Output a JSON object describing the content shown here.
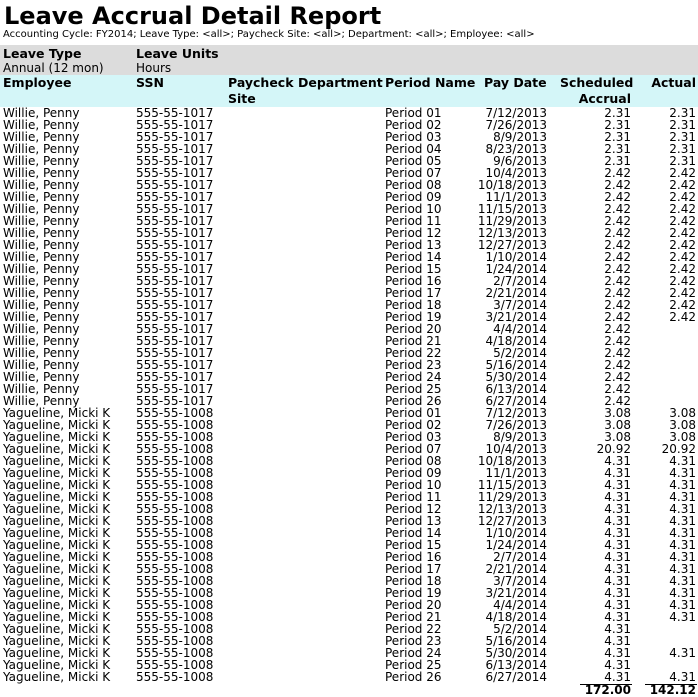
{
  "report": {
    "title": "Leave Accrual Detail Report",
    "subtitle": "Accounting Cycle: FY2014; Leave Type: <all>; Paycheck Site: <all>; Department: <all>; Employee: <all>"
  },
  "group_header": {
    "leave_type_label": "Leave Type",
    "leave_type_value": "Annual (12 mon)",
    "leave_units_label": "Leave Units",
    "leave_units_value": "Hours"
  },
  "columns": {
    "employee": "Employee",
    "ssn": "SSN",
    "paycheck_site_1": "Paycheck",
    "paycheck_site_2": "Site",
    "department": "Department",
    "period_name": "Period Name",
    "pay_date": "Pay Date",
    "scheduled_1": "Scheduled",
    "scheduled_2": "Accrual",
    "actual": "Actual"
  },
  "rows": [
    {
      "employee": "Willie,  Penny",
      "ssn": "555-55-1017",
      "period": "Period 01",
      "pay_date": "7/12/2013",
      "scheduled": "2.31",
      "actual": "2.31"
    },
    {
      "employee": "Willie,  Penny",
      "ssn": "555-55-1017",
      "period": "Period 02",
      "pay_date": "7/26/2013",
      "scheduled": "2.31",
      "actual": "2.31"
    },
    {
      "employee": "Willie,  Penny",
      "ssn": "555-55-1017",
      "period": "Period 03",
      "pay_date": "8/9/2013",
      "scheduled": "2.31",
      "actual": "2.31"
    },
    {
      "employee": "Willie,  Penny",
      "ssn": "555-55-1017",
      "period": "Period 04",
      "pay_date": "8/23/2013",
      "scheduled": "2.31",
      "actual": "2.31"
    },
    {
      "employee": "Willie,  Penny",
      "ssn": "555-55-1017",
      "period": "Period 05",
      "pay_date": "9/6/2013",
      "scheduled": "2.31",
      "actual": "2.31"
    },
    {
      "employee": "Willie,  Penny",
      "ssn": "555-55-1017",
      "period": "Period 07",
      "pay_date": "10/4/2013",
      "scheduled": "2.42",
      "actual": "2.42"
    },
    {
      "employee": "Willie,  Penny",
      "ssn": "555-55-1017",
      "period": "Period 08",
      "pay_date": "10/18/2013",
      "scheduled": "2.42",
      "actual": "2.42"
    },
    {
      "employee": "Willie,  Penny",
      "ssn": "555-55-1017",
      "period": "Period 09",
      "pay_date": "11/1/2013",
      "scheduled": "2.42",
      "actual": "2.42"
    },
    {
      "employee": "Willie,  Penny",
      "ssn": "555-55-1017",
      "period": "Period 10",
      "pay_date": "11/15/2013",
      "scheduled": "2.42",
      "actual": "2.42"
    },
    {
      "employee": "Willie,  Penny",
      "ssn": "555-55-1017",
      "period": "Period 11",
      "pay_date": "11/29/2013",
      "scheduled": "2.42",
      "actual": "2.42"
    },
    {
      "employee": "Willie,  Penny",
      "ssn": "555-55-1017",
      "period": "Period 12",
      "pay_date": "12/13/2013",
      "scheduled": "2.42",
      "actual": "2.42"
    },
    {
      "employee": "Willie,  Penny",
      "ssn": "555-55-1017",
      "period": "Period 13",
      "pay_date": "12/27/2013",
      "scheduled": "2.42",
      "actual": "2.42"
    },
    {
      "employee": "Willie,  Penny",
      "ssn": "555-55-1017",
      "period": "Period 14",
      "pay_date": "1/10/2014",
      "scheduled": "2.42",
      "actual": "2.42"
    },
    {
      "employee": "Willie,  Penny",
      "ssn": "555-55-1017",
      "period": "Period 15",
      "pay_date": "1/24/2014",
      "scheduled": "2.42",
      "actual": "2.42"
    },
    {
      "employee": "Willie,  Penny",
      "ssn": "555-55-1017",
      "period": "Period 16",
      "pay_date": "2/7/2014",
      "scheduled": "2.42",
      "actual": "2.42"
    },
    {
      "employee": "Willie,  Penny",
      "ssn": "555-55-1017",
      "period": "Period 17",
      "pay_date": "2/21/2014",
      "scheduled": "2.42",
      "actual": "2.42"
    },
    {
      "employee": "Willie,  Penny",
      "ssn": "555-55-1017",
      "period": "Period 18",
      "pay_date": "3/7/2014",
      "scheduled": "2.42",
      "actual": "2.42"
    },
    {
      "employee": "Willie,  Penny",
      "ssn": "555-55-1017",
      "period": "Period 19",
      "pay_date": "3/21/2014",
      "scheduled": "2.42",
      "actual": "2.42"
    },
    {
      "employee": "Willie,  Penny",
      "ssn": "555-55-1017",
      "period": "Period 20",
      "pay_date": "4/4/2014",
      "scheduled": "2.42",
      "actual": ""
    },
    {
      "employee": "Willie,  Penny",
      "ssn": "555-55-1017",
      "period": "Period 21",
      "pay_date": "4/18/2014",
      "scheduled": "2.42",
      "actual": ""
    },
    {
      "employee": "Willie,  Penny",
      "ssn": "555-55-1017",
      "period": "Period 22",
      "pay_date": "5/2/2014",
      "scheduled": "2.42",
      "actual": ""
    },
    {
      "employee": "Willie,  Penny",
      "ssn": "555-55-1017",
      "period": "Period 23",
      "pay_date": "5/16/2014",
      "scheduled": "2.42",
      "actual": ""
    },
    {
      "employee": "Willie,  Penny",
      "ssn": "555-55-1017",
      "period": "Period 24",
      "pay_date": "5/30/2014",
      "scheduled": "2.42",
      "actual": ""
    },
    {
      "employee": "Willie,  Penny",
      "ssn": "555-55-1017",
      "period": "Period 25",
      "pay_date": "6/13/2014",
      "scheduled": "2.42",
      "actual": ""
    },
    {
      "employee": "Willie,  Penny",
      "ssn": "555-55-1017",
      "period": "Period 26",
      "pay_date": "6/27/2014",
      "scheduled": "2.42",
      "actual": ""
    },
    {
      "employee": "Yagueline,  Micki K",
      "ssn": "555-55-1008",
      "period": "Period 01",
      "pay_date": "7/12/2013",
      "scheduled": "3.08",
      "actual": "3.08"
    },
    {
      "employee": "Yagueline,  Micki K",
      "ssn": "555-55-1008",
      "period": "Period 02",
      "pay_date": "7/26/2013",
      "scheduled": "3.08",
      "actual": "3.08"
    },
    {
      "employee": "Yagueline,  Micki K",
      "ssn": "555-55-1008",
      "period": "Period 03",
      "pay_date": "8/9/2013",
      "scheduled": "3.08",
      "actual": "3.08"
    },
    {
      "employee": "Yagueline,  Micki K",
      "ssn": "555-55-1008",
      "period": "Period 07",
      "pay_date": "10/4/2013",
      "scheduled": "20.92",
      "actual": "20.92"
    },
    {
      "employee": "Yagueline,  Micki K",
      "ssn": "555-55-1008",
      "period": "Period 08",
      "pay_date": "10/18/2013",
      "scheduled": "4.31",
      "actual": "4.31"
    },
    {
      "employee": "Yagueline,  Micki K",
      "ssn": "555-55-1008",
      "period": "Period 09",
      "pay_date": "11/1/2013",
      "scheduled": "4.31",
      "actual": "4.31"
    },
    {
      "employee": "Yagueline,  Micki K",
      "ssn": "555-55-1008",
      "period": "Period 10",
      "pay_date": "11/15/2013",
      "scheduled": "4.31",
      "actual": "4.31"
    },
    {
      "employee": "Yagueline,  Micki K",
      "ssn": "555-55-1008",
      "period": "Period 11",
      "pay_date": "11/29/2013",
      "scheduled": "4.31",
      "actual": "4.31"
    },
    {
      "employee": "Yagueline,  Micki K",
      "ssn": "555-55-1008",
      "period": "Period 12",
      "pay_date": "12/13/2013",
      "scheduled": "4.31",
      "actual": "4.31"
    },
    {
      "employee": "Yagueline,  Micki K",
      "ssn": "555-55-1008",
      "period": "Period 13",
      "pay_date": "12/27/2013",
      "scheduled": "4.31",
      "actual": "4.31"
    },
    {
      "employee": "Yagueline,  Micki K",
      "ssn": "555-55-1008",
      "period": "Period 14",
      "pay_date": "1/10/2014",
      "scheduled": "4.31",
      "actual": "4.31"
    },
    {
      "employee": "Yagueline,  Micki K",
      "ssn": "555-55-1008",
      "period": "Period 15",
      "pay_date": "1/24/2014",
      "scheduled": "4.31",
      "actual": "4.31"
    },
    {
      "employee": "Yagueline,  Micki K",
      "ssn": "555-55-1008",
      "period": "Period 16",
      "pay_date": "2/7/2014",
      "scheduled": "4.31",
      "actual": "4.31"
    },
    {
      "employee": "Yagueline,  Micki K",
      "ssn": "555-55-1008",
      "period": "Period 17",
      "pay_date": "2/21/2014",
      "scheduled": "4.31",
      "actual": "4.31"
    },
    {
      "employee": "Yagueline,  Micki K",
      "ssn": "555-55-1008",
      "period": "Period 18",
      "pay_date": "3/7/2014",
      "scheduled": "4.31",
      "actual": "4.31"
    },
    {
      "employee": "Yagueline,  Micki K",
      "ssn": "555-55-1008",
      "period": "Period 19",
      "pay_date": "3/21/2014",
      "scheduled": "4.31",
      "actual": "4.31"
    },
    {
      "employee": "Yagueline,  Micki K",
      "ssn": "555-55-1008",
      "period": "Period 20",
      "pay_date": "4/4/2014",
      "scheduled": "4.31",
      "actual": "4.31"
    },
    {
      "employee": "Yagueline,  Micki K",
      "ssn": "555-55-1008",
      "period": "Period 21",
      "pay_date": "4/18/2014",
      "scheduled": "4.31",
      "actual": "4.31"
    },
    {
      "employee": "Yagueline,  Micki K",
      "ssn": "555-55-1008",
      "period": "Period 22",
      "pay_date": "5/2/2014",
      "scheduled": "4.31",
      "actual": ""
    },
    {
      "employee": "Yagueline,  Micki K",
      "ssn": "555-55-1008",
      "period": "Period 23",
      "pay_date": "5/16/2014",
      "scheduled": "4.31",
      "actual": ""
    },
    {
      "employee": "Yagueline,  Micki K",
      "ssn": "555-55-1008",
      "period": "Period 24",
      "pay_date": "5/30/2014",
      "scheduled": "4.31",
      "actual": "4.31"
    },
    {
      "employee": "Yagueline,  Micki K",
      "ssn": "555-55-1008",
      "period": "Period 25",
      "pay_date": "6/13/2014",
      "scheduled": "4.31",
      "actual": ""
    },
    {
      "employee": "Yagueline,  Micki K",
      "ssn": "555-55-1008",
      "period": "Period 26",
      "pay_date": "6/27/2014",
      "scheduled": "4.31",
      "actual": "4.31"
    }
  ],
  "totals": {
    "scheduled": "172.00",
    "actual": "142.12"
  },
  "colors": {
    "group_band": "#dcdcdc",
    "column_band": "#d4f6f8"
  }
}
